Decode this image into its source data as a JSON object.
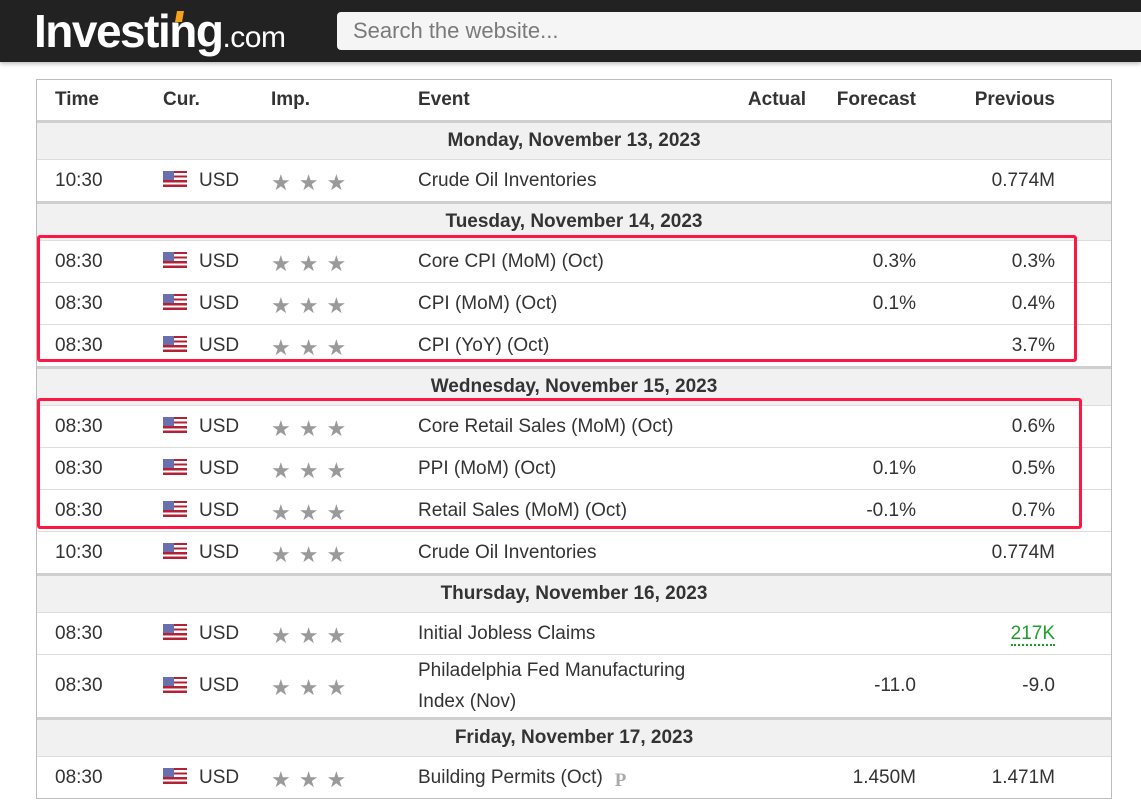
{
  "header": {
    "logo_main": "Investing",
    "logo_suffix": ".com",
    "search_placeholder": "Search the website..."
  },
  "colors": {
    "brand_accent": "#f7a21b",
    "topbar_bg": "#222222",
    "highlight_border": "#ff1744",
    "positive_green": "#1e9f29"
  },
  "table": {
    "columns": [
      "Time",
      "Cur.",
      "Imp.",
      "Event",
      "Actual",
      "Forecast",
      "Previous"
    ],
    "groups": [
      {
        "date": "Monday, November 13, 2023",
        "rows": [
          {
            "time": "10:30",
            "currency": "USD",
            "flag": "us-flag-icon",
            "importance": 3,
            "stars": "★★★",
            "event": "Crude Oil Inventories",
            "actual": "",
            "forecast": "",
            "previous": "0.774M"
          }
        ]
      },
      {
        "date": "Tuesday, November 14, 2023",
        "highlighted": true,
        "rows": [
          {
            "time": "08:30",
            "currency": "USD",
            "flag": "us-flag-icon",
            "importance": 3,
            "stars": "★★★",
            "event": "Core CPI (MoM) (Oct)",
            "actual": "",
            "forecast": "0.3%",
            "previous": "0.3%"
          },
          {
            "time": "08:30",
            "currency": "USD",
            "flag": "us-flag-icon",
            "importance": 3,
            "stars": "★★★",
            "event": "CPI (MoM) (Oct)",
            "actual": "",
            "forecast": "0.1%",
            "previous": "0.4%"
          },
          {
            "time": "08:30",
            "currency": "USD",
            "flag": "us-flag-icon",
            "importance": 3,
            "stars": "★★★",
            "event": "CPI (YoY) (Oct)",
            "actual": "",
            "forecast": "",
            "previous": "3.7%"
          }
        ]
      },
      {
        "date": "Wednesday, November 15, 2023",
        "highlighted": true,
        "rows": [
          {
            "time": "08:30",
            "currency": "USD",
            "flag": "us-flag-icon",
            "importance": 3,
            "stars": "★★★",
            "event": "Core Retail Sales (MoM) (Oct)",
            "actual": "",
            "forecast": "",
            "previous": "0.6%"
          },
          {
            "time": "08:30",
            "currency": "USD",
            "flag": "us-flag-icon",
            "importance": 3,
            "stars": "★★★",
            "event": "PPI (MoM) (Oct)",
            "actual": "",
            "forecast": "0.1%",
            "previous": "0.5%"
          },
          {
            "time": "08:30",
            "currency": "USD",
            "flag": "us-flag-icon",
            "importance": 3,
            "stars": "★★★",
            "event": "Retail Sales (MoM) (Oct)",
            "actual": "",
            "forecast": "-0.1%",
            "previous": "0.7%"
          },
          {
            "time": "10:30",
            "currency": "USD",
            "flag": "us-flag-icon",
            "importance": 3,
            "stars": "★★★",
            "event": "Crude Oil Inventories",
            "actual": "",
            "forecast": "",
            "previous": "0.774M"
          }
        ]
      },
      {
        "date": "Thursday, November 16, 2023",
        "rows": [
          {
            "time": "08:30",
            "currency": "USD",
            "flag": "us-flag-icon",
            "importance": 3,
            "stars": "★★★",
            "event": "Initial Jobless Claims",
            "actual": "",
            "forecast": "",
            "previous": "217K",
            "previous_style": "green-link"
          },
          {
            "time": "08:30",
            "currency": "USD",
            "flag": "us-flag-icon",
            "importance": 3,
            "stars": "★★★",
            "event_line1": "Philadelphia Fed Manufacturing",
            "event_line2": "Index (Nov)",
            "actual": "",
            "forecast": "-11.0",
            "previous": "-9.0"
          }
        ]
      },
      {
        "date": "Friday, November 17, 2023",
        "rows": [
          {
            "time": "08:30",
            "currency": "USD",
            "flag": "us-flag-icon",
            "importance": 3,
            "stars": "★★★",
            "event": "Building Permits (Oct)",
            "preliminary_badge": "P",
            "actual": "",
            "forecast": "1.450M",
            "previous": "1.471M"
          }
        ]
      }
    ]
  }
}
